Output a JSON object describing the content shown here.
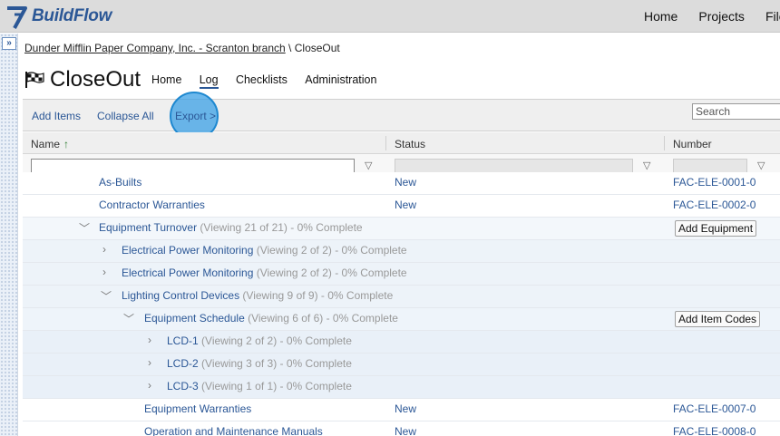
{
  "app": {
    "logo_text": "BuildFlow",
    "top_nav": [
      "Home",
      "Projects",
      "File"
    ]
  },
  "breadcrumb": {
    "company": "Dunder Mifflin Paper Company, Inc. - Scranton branch",
    "separator": "\\",
    "current": "CloseOut"
  },
  "page": {
    "title": "CloseOut",
    "tabs": [
      {
        "label": "Home",
        "active": false
      },
      {
        "label": "Log",
        "active": true
      },
      {
        "label": "Checklists",
        "active": false
      },
      {
        "label": "Administration",
        "active": false
      }
    ]
  },
  "toolbar": {
    "add_items": "Add Items",
    "collapse_all": "Collapse All",
    "export": "Export >",
    "search_placeholder": "Search"
  },
  "grid": {
    "columns": {
      "name": "Name",
      "sort_arrow": "↑",
      "status": "Status",
      "number": "Number"
    },
    "rows": [
      {
        "label": "As-Builts",
        "meta": "",
        "status": "New",
        "number": "FAC-ELE-0001-0",
        "chevron": "",
        "button": ""
      },
      {
        "label": "Contractor Warranties",
        "meta": "",
        "status": "New",
        "number": "FAC-ELE-0002-0",
        "chevron": "",
        "button": ""
      },
      {
        "label": "Equipment Turnover",
        "meta": "(Viewing 21 of 21) - 0% Complete",
        "status": "",
        "number": "",
        "chevron": "down",
        "button": "Add Equipment"
      },
      {
        "label": "Electrical Power Monitoring",
        "meta": "(Viewing 2 of 2) - 0% Complete",
        "status": "",
        "number": "",
        "chevron": "right",
        "button": ""
      },
      {
        "label": "Electrical Power Monitoring",
        "meta": "(Viewing 2 of 2) - 0% Complete",
        "status": "",
        "number": "",
        "chevron": "right",
        "button": ""
      },
      {
        "label": "Lighting Control Devices",
        "meta": "(Viewing 9 of 9) - 0% Complete",
        "status": "",
        "number": "",
        "chevron": "down",
        "button": ""
      },
      {
        "label": "Equipment Schedule",
        "meta": "(Viewing 6 of 6) - 0% Complete",
        "status": "",
        "number": "",
        "chevron": "down",
        "button": "Add Item Codes"
      },
      {
        "label": "LCD-1",
        "meta": "(Viewing 2 of 2) - 0% Complete",
        "status": "",
        "number": "",
        "chevron": "right",
        "button": ""
      },
      {
        "label": "LCD-2",
        "meta": "(Viewing 3 of 3) - 0% Complete",
        "status": "",
        "number": "",
        "chevron": "right",
        "button": ""
      },
      {
        "label": "LCD-3",
        "meta": "(Viewing 1 of 1) - 0% Complete",
        "status": "",
        "number": "",
        "chevron": "right",
        "button": ""
      },
      {
        "label": "Equipment Warranties",
        "meta": "",
        "status": "New",
        "number": "FAC-ELE-0007-0",
        "chevron": "",
        "button": ""
      },
      {
        "label": "Operation and Maintenance Manuals",
        "meta": "",
        "status": "New",
        "number": "FAC-ELE-0008-0",
        "chevron": "",
        "button": ""
      }
    ]
  },
  "colors": {
    "link_blue": "#2b5796",
    "highlight": "#3ba0e6",
    "sort_arrow": "#2e7d32"
  }
}
